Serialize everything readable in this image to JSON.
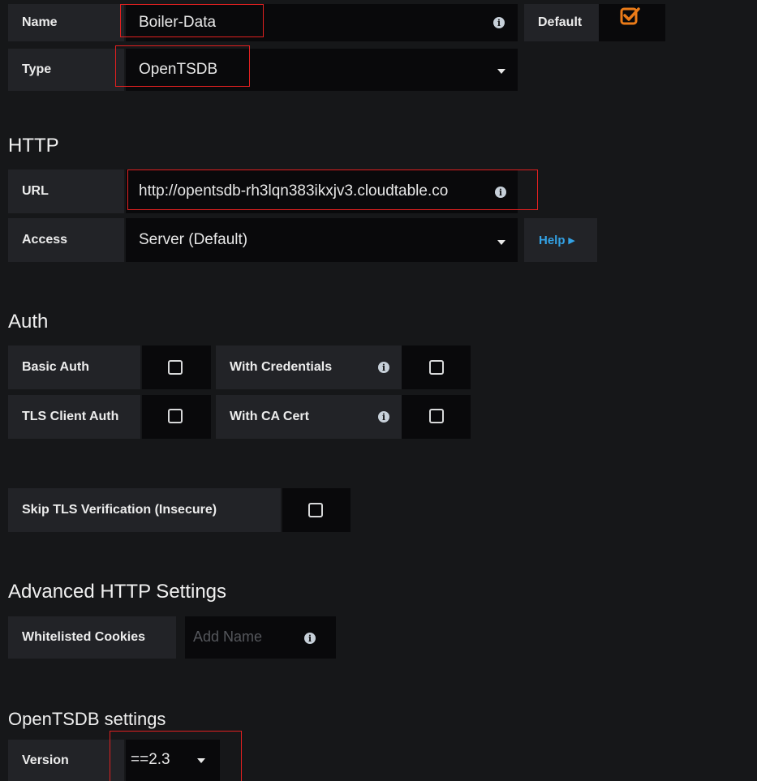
{
  "general": {
    "name_label": "Name",
    "name_value": "Boiler-Data",
    "default_label": "Default",
    "default_checked": true,
    "type_label": "Type",
    "type_value": "OpenTSDB"
  },
  "http": {
    "heading": "HTTP",
    "url_label": "URL",
    "url_value": "http://opentsdb-rh3lqn383ikxjv3.cloudtable.co",
    "access_label": "Access",
    "access_value": "Server (Default)",
    "help_label": "Help ▸"
  },
  "auth": {
    "heading": "Auth",
    "basic_auth_label": "Basic Auth",
    "with_credentials_label": "With Credentials",
    "tls_client_auth_label": "TLS Client Auth",
    "with_ca_cert_label": "With CA Cert",
    "skip_tls_label": "Skip TLS Verification (Insecure)"
  },
  "advanced": {
    "heading": "Advanced HTTP Settings",
    "whitelisted_cookies_label": "Whitelisted Cookies",
    "add_name_placeholder": "Add Name"
  },
  "opentsdb": {
    "heading": "OpenTSDB settings",
    "version_label": "Version",
    "version_value": "==2.3"
  },
  "colors": {
    "background": "#161719",
    "label_bg": "#222327",
    "input_bg": "#09090b",
    "accent_orange": "#eb7b18",
    "help_blue": "#33a2e5",
    "highlight_red": "#e02020"
  }
}
